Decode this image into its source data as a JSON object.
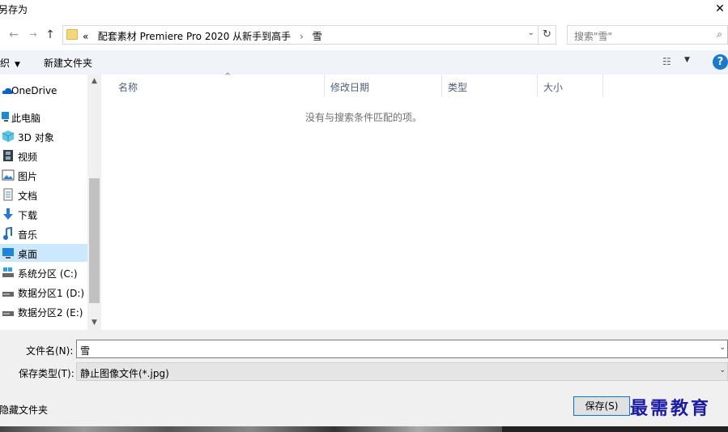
{
  "window": {
    "title": "另存为",
    "close": "✕"
  },
  "nav": {
    "back": "←",
    "forward": "→",
    "recent": "⌄",
    "up": "↑",
    "address": {
      "prefix": "«",
      "path": "配套素材 Premiere Pro 2020 从新手到高手",
      "separator": "›",
      "current": "雪",
      "dropdown": "⌄"
    },
    "refresh": "↻",
    "search_placeholder": "搜索\"雪\"",
    "search_icon": "⌕"
  },
  "toolbar": {
    "organize": "织",
    "organize_caret": "▼",
    "new_folder": "新建文件夹",
    "view_icon": "☷",
    "view_caret": "▼",
    "help": "?"
  },
  "sidebar": {
    "items": [
      {
        "label": "OneDrive",
        "icon": "cloud-icon"
      },
      {
        "label": "此电脑",
        "icon": "computer-icon"
      },
      {
        "label": "3D 对象",
        "icon": "cube-icon"
      },
      {
        "label": "视频",
        "icon": "film-icon"
      },
      {
        "label": "图片",
        "icon": "picture-icon"
      },
      {
        "label": "文档",
        "icon": "document-icon"
      },
      {
        "label": "下载",
        "icon": "download-icon"
      },
      {
        "label": "音乐",
        "icon": "music-icon"
      },
      {
        "label": "桌面",
        "icon": "desktop-icon",
        "selected": true
      },
      {
        "label": "系统分区 (C:)",
        "icon": "system-drive-icon"
      },
      {
        "label": "数据分区1 (D:)",
        "icon": "drive-icon"
      },
      {
        "label": "数据分区2 (E:)",
        "icon": "drive-icon"
      }
    ],
    "scroll_up": "▲",
    "scroll_down": "▼"
  },
  "list": {
    "columns": [
      "名称",
      "修改日期",
      "类型",
      "大小"
    ],
    "sort_indicator": "^",
    "empty_message": "没有与搜索条件匹配的项。"
  },
  "form": {
    "filename_label": "文件名(N):",
    "filename_value": "雪",
    "filetype_label": "保存类型(T):",
    "filetype_value": "静止图像文件(*.jpg)",
    "caret": "⌄",
    "hide_folders": "隐藏文件夹",
    "save_button": "保存(S)"
  },
  "watermark": "最需教育",
  "colors": {
    "selected_bg": "#cce8ff",
    "toolbar_bg": "#f0f4f9",
    "help_blue": "#1979ca",
    "watermark": "#1a1aa6"
  }
}
